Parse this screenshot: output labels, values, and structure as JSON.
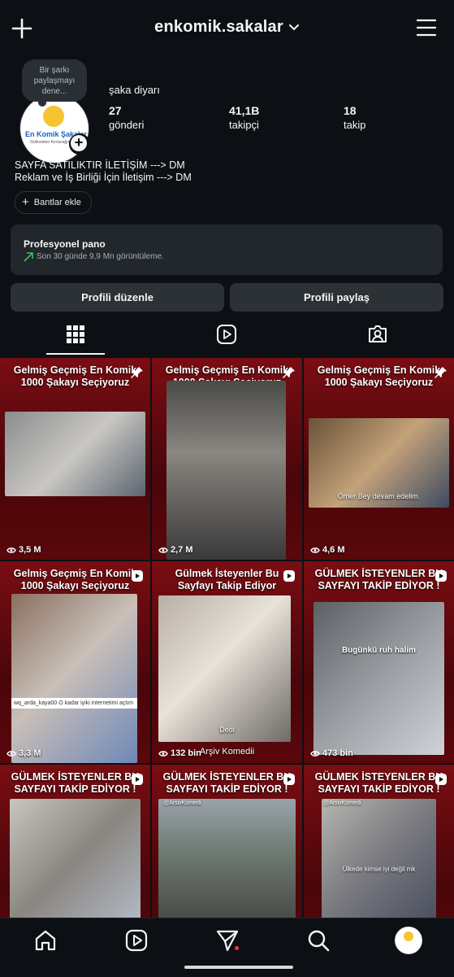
{
  "header": {
    "username": "enkomik.sakalar"
  },
  "profile": {
    "note": "Bir şarkı paylaşmayı dene...",
    "avatar_logo_title": "En Komik Şakalar",
    "avatar_logo_subtitle": "Gülmekten Kırılacağınız Şakalar",
    "name": "şaka diyarı",
    "stats": [
      {
        "value": "27",
        "label": "gönderi"
      },
      {
        "value": "41,1B",
        "label": "takipçi"
      },
      {
        "value": "18",
        "label": "takip"
      }
    ],
    "bio_line1": "SAYFA SATILIKTIR İLETİŞİM ---> DM",
    "bio_line2": "Reklam ve İş Birliği İçin İletişim  ---> DM",
    "add_highlights": "Bantlar ekle"
  },
  "pro_dashboard": {
    "title": "Profesyonel pano",
    "subtitle": "Son 30 günde 9,9 Mn görüntüleme."
  },
  "buttons": {
    "edit": "Profili düzenle",
    "share": "Profili paylaş"
  },
  "posts": [
    {
      "caption": "Gelmiş Geçmiş En Komik 1000 Şakayı Seçiyoruz",
      "views": "3,5 M",
      "badge": "pin"
    },
    {
      "caption": "Gelmiş Geçmiş En Komik 1000 Şakayı Seçiyoruz",
      "views": "2,7 M",
      "badge": "pin"
    },
    {
      "caption": "Gelmiş Geçmiş En Komik 1000 Şakayı Seçiyoruz",
      "views": "4,6 M",
      "badge": "pin",
      "subtitle": "Ömer Bey devam edelim."
    },
    {
      "caption": "Gelmiş Geçmiş En Komik 1000 Şakayı Seçiyoruz",
      "views": "3,3 M",
      "badge": "reel",
      "subtitle": "wq_arda_kaya00 O kadar iyiki internetimi açtım"
    },
    {
      "caption": "Gülmek İsteyenler Bu Sayfayı Takip Ediyor",
      "views": "132 bin",
      "badge": "reel",
      "subtitle": "Dedi",
      "watermark": "Arşiv Komedii"
    },
    {
      "caption": "GÜLMEK İSTEYENLER BU SAYFAYI TAKİP EDİYOR !",
      "views": "473 bin",
      "badge": "reel",
      "subtitle": "Bugünkü ruh halim"
    },
    {
      "caption": "GÜLMEK İSTEYENLER BU SAYFAYI TAKİP EDİYOR !",
      "views": "",
      "badge": "reel"
    },
    {
      "caption": "GÜLMEK İSTEYENLER BU SAYFAYI TAKİP EDİYOR !",
      "views": "",
      "badge": "reel",
      "tag": "@ArsivKomedi"
    },
    {
      "caption": "GÜLMEK İSTEYENLER BU SAYFAYI TAKİP EDİYOR !",
      "views": "",
      "badge": "reel",
      "tag": "@ArsivKomedi",
      "subtitle": "Ülkede kimse iyi değil mk"
    }
  ]
}
